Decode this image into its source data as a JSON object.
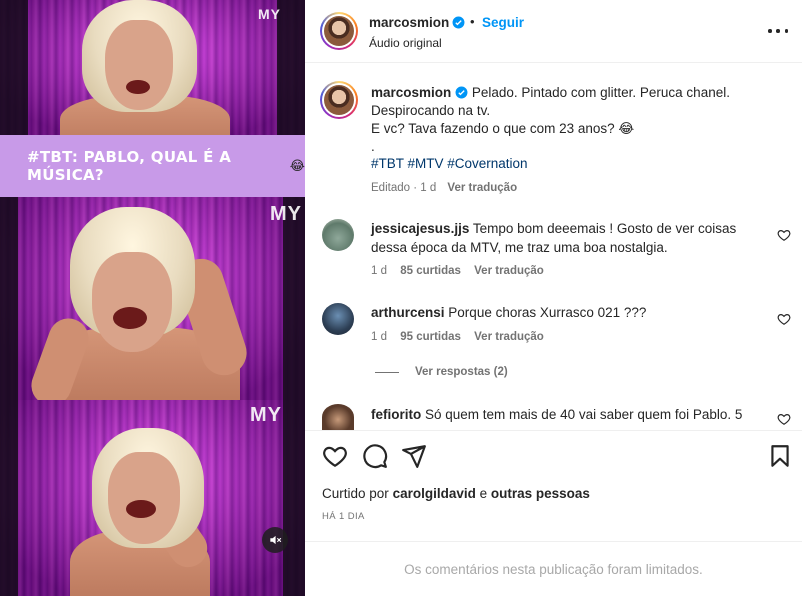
{
  "media": {
    "banner_text": "#TBT: PABLO, QUAL É A MÚSICA?",
    "banner_emoji": "😂",
    "watermark": "MY",
    "mute_icon": "speaker-muted-icon"
  },
  "header": {
    "username": "marcosmion",
    "separator": "•",
    "follow_label": "Seguir",
    "audio_label": "Áudio original"
  },
  "caption": {
    "username": "marcosmion",
    "line1": "Pelado. Pintado com glitter. Peruca chanel.",
    "line2": "Despirocando na tv.",
    "line3": "E vc? Tava fazendo o que com 23 anos? 😂",
    "line4": ".",
    "hashtags": "#TBT #MTV #Covernation",
    "edited": "Editado · 1 d",
    "see_translation": "Ver tradução"
  },
  "comments": [
    {
      "username": "jessicajesus.jjs",
      "text_line1": "Tempo bom deeemais ! Gosto de ver coisas",
      "text_line2": "dessa época da MTV, me traz uma boa nostalgia.",
      "age": "1 d",
      "likes": "85 curtidas",
      "translate": "Ver tradução"
    },
    {
      "username": "arthurcensi",
      "text_line1": "Porque choras Xurrasco 021 ???",
      "age": "1 d",
      "likes": "95 curtidas",
      "translate": "Ver tradução",
      "replies": "Ver respostas (2)"
    },
    {
      "username": "fefiorito",
      "text_line1": "Só quem tem mais de 40 vai saber quem foi Pablo. 5"
    }
  ],
  "footer": {
    "liked_prefix": "Curtido por",
    "liked_user": "carolgildavid",
    "liked_and": "e",
    "liked_others": "outras pessoas",
    "time": "HÁ 1 DIA",
    "limited": "Os comentários nesta publicação foram limitados."
  },
  "colors": {
    "accent": "#0095f6",
    "hashtag": "#00376b",
    "muted": "#737373",
    "banner": "#c89ae8"
  }
}
